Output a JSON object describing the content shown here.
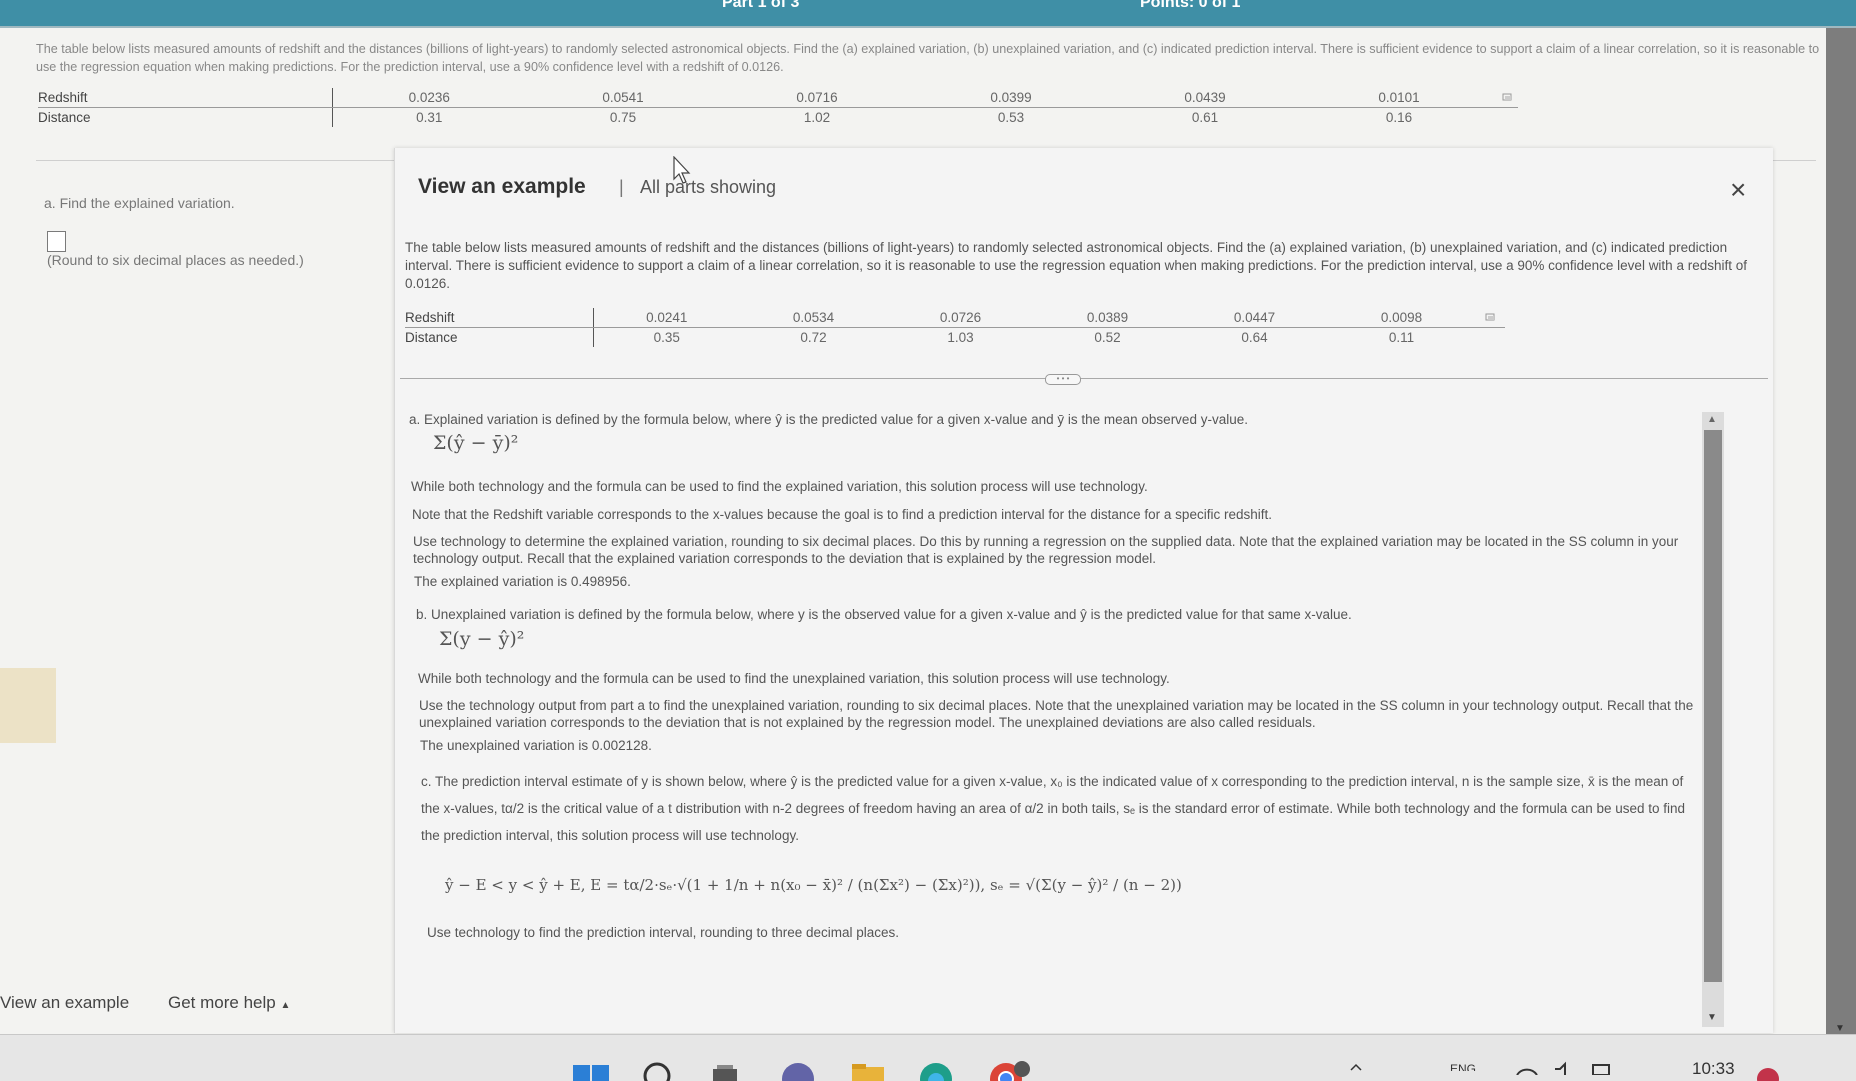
{
  "header": {
    "title_fragment": "Part 1 of 3",
    "points_fragment": "Points: 0 of 1"
  },
  "question": {
    "intro": "The table below lists measured amounts of redshift and the distances (billions of light-years) to randomly selected astronomical objects. Find the (a) explained variation, (b) unexplained variation, and (c) indicated prediction interval. There is sufficient evidence to support a claim of a linear correlation, so it is reasonable to use the regression equation when making predictions. For the prediction interval, use a 90% confidence level with a redshift of 0.0126.",
    "table": {
      "row1_label": "Redshift",
      "row2_label": "Distance",
      "redshift": [
        "0.0236",
        "0.0541",
        "0.0716",
        "0.0399",
        "0.0439",
        "0.0101"
      ],
      "distance": [
        "0.31",
        "0.75",
        "1.02",
        "0.53",
        "0.61",
        "0.16"
      ]
    },
    "part_a_label": "a. Find the explained variation.",
    "round_note": "(Round to six decimal places as needed.)"
  },
  "bottom_links": {
    "example": "View an example",
    "help": "Get more help"
  },
  "modal": {
    "title": "View an example",
    "separator": "|",
    "subtitle": "All parts showing",
    "close": "×",
    "intro": "The table below lists measured amounts of redshift and the distances (billions of light-years) to randomly selected astronomical objects. Find the (a) explained variation, (b) unexplained variation, and (c) indicated prediction interval. There is sufficient evidence to support a claim of a linear correlation, so it is reasonable to use the regression equation when making predictions. For the prediction interval, use a 90% confidence level with a redshift of 0.0126.",
    "table": {
      "row1_label": "Redshift",
      "row2_label": "Distance",
      "redshift": [
        "0.0241",
        "0.0534",
        "0.0726",
        "0.0389",
        "0.0447",
        "0.0098"
      ],
      "distance": [
        "0.35",
        "0.72",
        "1.03",
        "0.52",
        "0.64",
        "0.11"
      ]
    },
    "solution": {
      "a_def": "a. Explained variation is defined by the formula below, where ŷ is the predicted value for a given x-value and ȳ is the mean observed y-value.",
      "a_formula": "Σ(ŷ − ȳ)²",
      "a_tech": "While both technology and the formula can be used to find the explained variation, this solution process will use technology.",
      "a_note": "Note that the Redshift variable corresponds to the x-values because the goal is to find a prediction interval for the distance for a specific redshift.",
      "a_use": "Use technology to determine the explained variation, rounding to six decimal places. Do this by running a regression on the supplied data. Note that the explained variation may be located in the SS column in your technology output. Recall that the explained variation corresponds to the deviation that is explained by the regression model.",
      "a_result": "The explained variation is 0.498956.",
      "b_def": "b. Unexplained variation is defined by the formula below, where y is the observed value for a given x-value and ŷ is the predicted value for that same x-value.",
      "b_formula": "Σ(y − ŷ)²",
      "b_tech": "While both technology and the formula can be used to find the unexplained variation, this solution process will use technology.",
      "b_use": "Use the technology output from part a to find the unexplained variation, rounding to six decimal places. Note that the unexplained variation may be located in the SS column in your technology output. Recall that the unexplained variation corresponds to the deviation that is not explained by the regression model. The unexplained deviations are also called residuals.",
      "b_result": "The unexplained variation is 0.002128.",
      "c_def": "c. The prediction interval estimate of y is shown below, where ŷ is the predicted value for a given x-value, x₀ is the indicated value of x corresponding to the prediction interval, n is the sample size, x̄ is the mean of the x-values, tα/2 is the critical value of a t distribution with n-2 degrees of freedom having an area of α/2 in both tails, sₑ is the standard error of estimate. While both technology and the formula can be used to find the prediction interval, this solution process will use technology.",
      "c_formula": "ŷ − E < y < ŷ + E, E = tα/2·sₑ·√(1 + 1/n + n(x₀ − x̄)² / (n(Σx²) − (Σx)²)), sₑ = √(Σ(y − ŷ)² / (n − 2))",
      "c_use": "Use technology to find the prediction interval, rounding to three decimal places."
    }
  },
  "taskbar": {
    "time": "10:33"
  }
}
